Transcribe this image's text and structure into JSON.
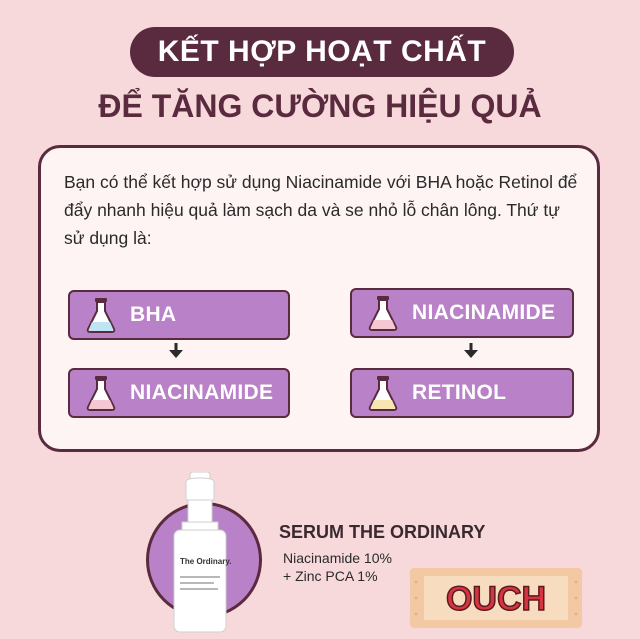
{
  "header": {
    "title": "KẾT HỢP HOẠT CHẤT",
    "subtitle": "ĐỂ TĂNG CƯỜNG HIỆU QUẢ"
  },
  "card": {
    "description": "Bạn có thể kết hợp sử dụng Niacinamide với BHA hoặc Retinol để đẩy nhanh hiệu quả làm sạch da và se nhỏ lỗ chân lông. Thứ tự sử dụng là:",
    "left_combo": {
      "first": "BHA",
      "second": "NIACINAMIDE"
    },
    "right_combo": {
      "first": "NIACINAMIDE",
      "second": "RETINOL"
    }
  },
  "product": {
    "title": "SERUM THE ORDINARY",
    "line1": "Niacinamide 10%",
    "line2": "+ Zinc PCA 1%",
    "bottle_brand": "The Ordinary."
  },
  "logo": {
    "text": "OUCH"
  },
  "colors": {
    "background": "#f7d9dc",
    "accent_dark": "#5a2a3e",
    "step_purple": "#b981c7",
    "logo_red": "#d8343f",
    "logo_band": "#f2c9a3"
  }
}
